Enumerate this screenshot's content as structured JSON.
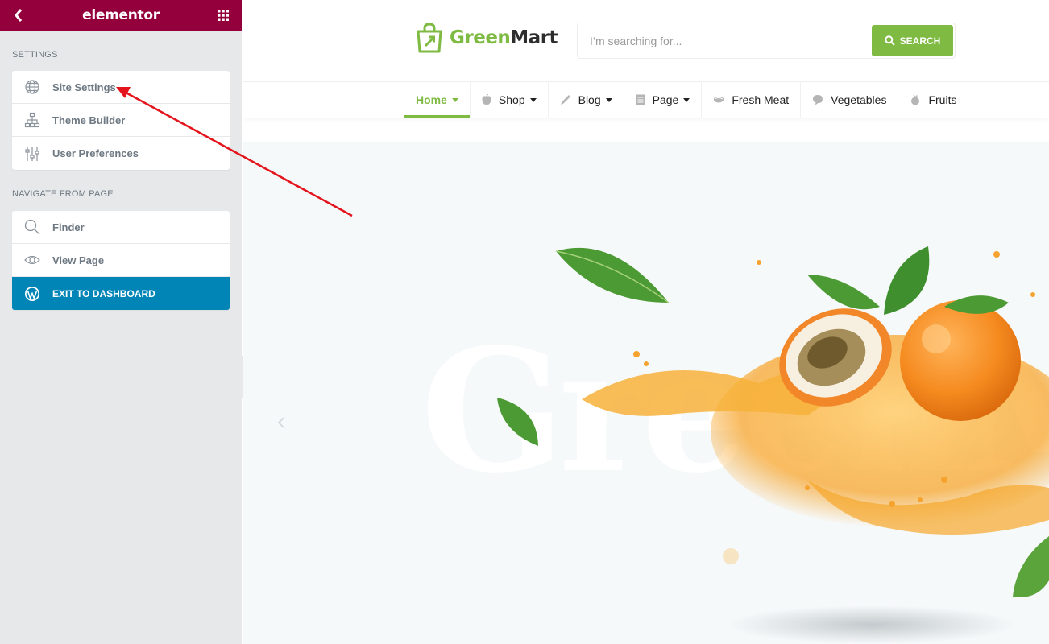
{
  "panel": {
    "logo": "elementor",
    "header_color": "#93003c",
    "icons": {
      "back": "chevron-left-icon",
      "menu": "grid-icon"
    },
    "settings_section": {
      "title": "SETTINGS",
      "items": [
        {
          "label": "Site Settings",
          "icon": "globe-icon"
        },
        {
          "label": "Theme Builder",
          "icon": "sitemap-icon"
        },
        {
          "label": "User Preferences",
          "icon": "sliders-icon"
        }
      ]
    },
    "navigate_section": {
      "title": "NAVIGATE FROM PAGE",
      "items": [
        {
          "label": "Finder",
          "icon": "search-icon"
        },
        {
          "label": "View Page",
          "icon": "eye-icon"
        },
        {
          "label": "EXIT TO DASHBOARD",
          "icon": "wordpress-icon",
          "color": "#0185b7"
        }
      ]
    }
  },
  "site": {
    "brand": {
      "part1": "Green",
      "part2": "Mart",
      "accent_color": "#7fba42",
      "icon": "shopping-bag-icon"
    },
    "search": {
      "placeholder": "I’m searching for...",
      "button_label": "SEARCH",
      "icon": "search-icon"
    },
    "nav": [
      {
        "label": "Home",
        "active": true,
        "dropdown": true
      },
      {
        "label": "Shop",
        "dropdown": true,
        "icon": "apple-icon"
      },
      {
        "label": "Blog",
        "dropdown": true,
        "icon": "pencil-icon"
      },
      {
        "label": "Page",
        "dropdown": true,
        "icon": "document-icon"
      },
      {
        "label": "Fresh Meat",
        "icon": "meat-icon"
      },
      {
        "label": "Vegetables",
        "icon": "vegetable-icon"
      },
      {
        "label": "Fruits",
        "icon": "fruit-icon"
      }
    ],
    "hero": {
      "watermark": "GreenMart",
      "prev_icon": "chevron-left-icon"
    }
  },
  "annotation": {
    "type": "arrow",
    "color": "#e3141b",
    "target": "Site Settings"
  }
}
